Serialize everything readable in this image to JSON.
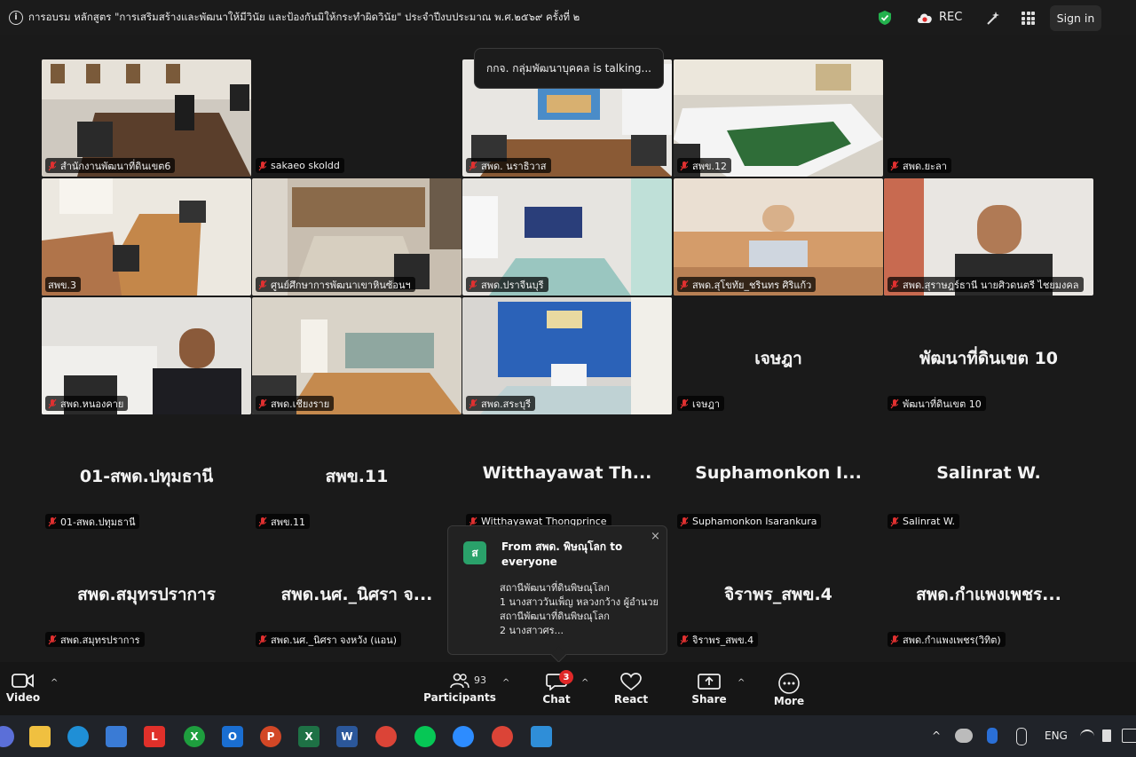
{
  "top_bar": {
    "title": "การอบรม หลักสูตร \"การเสริมสร้างและพัฒนาให้มีวินัย และป้องกันมิให้กระทำผิดวินัย\" ประจำปีงบประมาณ พ.ศ.๒๕๖๙ ครั้งที่ ๒",
    "rec_label": "REC",
    "signin_label": "Sign in"
  },
  "talking_indicator": "กกจ. กลุ่มพัฒนาบุคคล is talking...",
  "tiles_video": [
    {
      "name": "สำนักงานพัฒนาที่ดินเขต6"
    },
    {
      "name": "sakaeo skoldd"
    },
    {
      "name": "สพด. นราธิวาส"
    },
    {
      "name": "สพข.12"
    },
    {
      "name": "สพด.ยะลา"
    },
    {
      "name": "สพข.3"
    },
    {
      "name": "ศูนย์ศึกษาการพัฒนาเขาหินซ้อนฯ"
    },
    {
      "name": "สพด.ปราจีนบุรี"
    },
    {
      "name": "สพด.สุโขทัย_ชรินทร ศิริแก้ว"
    },
    {
      "name": "สพด.สุราษฎร์ธานี นายศิวดนตรี ไชยมงคล"
    },
    {
      "name": "สพด.หนองคาย"
    },
    {
      "name": "สพด.เชียงราย"
    },
    {
      "name": "สพด.สระบุรี"
    }
  ],
  "tiles_name": [
    {
      "big": "เจษฎา",
      "name": "เจษฎา"
    },
    {
      "big": "พัฒนาที่ดินเขต 10",
      "name": "พัฒนาที่ดินเขต 10"
    },
    {
      "big": "01-สพด.ปทุมธานี",
      "name": "01-สพด.ปทุมธานี"
    },
    {
      "big": "สพข.11",
      "name": "สพข.11"
    },
    {
      "big": "Witthayawat  Th...",
      "name": "Witthayawat Thongprince"
    },
    {
      "big": "Suphamonkon  I...",
      "name": "Suphamonkon Isarankura"
    },
    {
      "big": "Salinrat W.",
      "name": "Salinrat W."
    },
    {
      "big": "สพด.สมุทรปราการ",
      "name": "สพด.สมุทรปราการ"
    },
    {
      "big": "สพด.นศ._นิศรา จ...",
      "name": "สพด.นศ._นิศรา จงหวัง (แอน)"
    },
    {
      "big": "จิราพร_สพข.4",
      "name": "จิราพร_สพข.4"
    },
    {
      "big": "สพด.กำแพงเพชร...",
      "name": "สพด.กำแพงเพชร(วิทิต)"
    }
  ],
  "chat_toast": {
    "avatar_letter": "ส",
    "from": "From สพด. พิษณุโลก to everyone",
    "message": "สถานีพัฒนาที่ดินพิษณุโลก\n1 นางสาววันเพ็ญ  หลวงกว้าง   ผู้อำนวยสถานีพัฒนาที่ดินพิษณุโลก\n2 นางสาวศร...",
    "close": "×"
  },
  "controls": {
    "video_label": "Video",
    "participants_label": "Participants",
    "participants_count": "93",
    "chat_label": "Chat",
    "chat_badge": "3",
    "react_label": "React",
    "share_label": "Share",
    "more_label": "More"
  },
  "taskbar": {
    "language": "ENG"
  }
}
